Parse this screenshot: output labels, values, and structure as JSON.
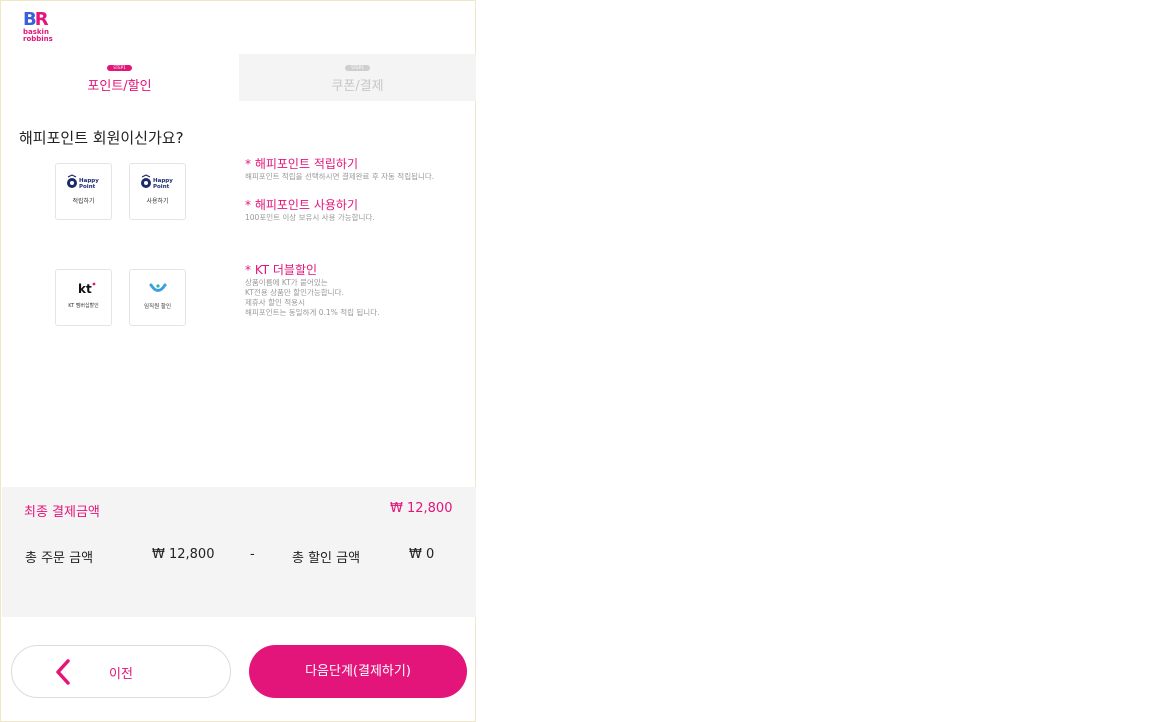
{
  "brand": {
    "logo_top": "BR",
    "logo_line1": "baskin",
    "logo_line2": "robbins"
  },
  "tabs": [
    {
      "badge": "STEP1",
      "label": "포인트/할인",
      "active": true
    },
    {
      "badge": "STEP2",
      "label": "쿠폰/결제",
      "active": false
    }
  ],
  "question": "해피포인트 회원이신가요?",
  "options": {
    "happy_earn": {
      "logo_text_1": "Happy",
      "logo_text_2": "Point",
      "caption": "적립하기"
    },
    "happy_use": {
      "logo_text_1": "Happy",
      "logo_text_2": "Point",
      "caption": "사용하기"
    },
    "kt": {
      "logo_text": "kt",
      "caption": "KT 멤버십할인"
    },
    "other": {
      "caption": "임직원 할인"
    }
  },
  "info": {
    "earn": {
      "title": "* 해피포인트 적립하기",
      "desc": "해피포인트 적립을 선택하시면 결제완료 후 자동 적립됩니다."
    },
    "use": {
      "title": "* 해피포인트 사용하기",
      "desc": "100포인트 이상 보유시 사용 가능합니다."
    },
    "kt": {
      "title": "* KT 더블할인",
      "lines": [
        "상품이름에 KT가 붙어있는",
        "KT전용 상품만 할인가능합니다.",
        "제휴사 할인 적용시",
        "해피포인트는 동일하게 0.1% 적립 됩니다."
      ]
    }
  },
  "summary": {
    "final_label": "최종 결제금액",
    "final_value": "₩ 12,800",
    "order_label": "총 주문 금액",
    "order_value": "₩ 12,800",
    "minus": "-",
    "discount_label": "총 할인 금액",
    "discount_value": "₩ 0"
  },
  "buttons": {
    "prev": "이전",
    "next": "다음단계(결제하기)"
  },
  "colors": {
    "accent": "#e3157a",
    "brand_blue": "#3b5fd9",
    "navy": "#1b2a6b"
  }
}
